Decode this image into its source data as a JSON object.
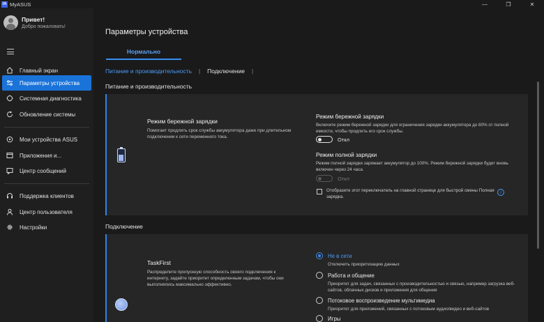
{
  "app": {
    "logo": "/A",
    "title": "MyASUS"
  },
  "window": {
    "minimize": "—",
    "maximize": "❐",
    "close": "✕"
  },
  "user": {
    "greeting": "Привет!",
    "welcome": "Добро пожаловать!"
  },
  "sidebar": {
    "items": [
      {
        "label": "Главный экран",
        "icon": "home-icon"
      },
      {
        "label": "Параметры устройства",
        "icon": "sliders-icon",
        "active": true
      },
      {
        "label": "Системная диагностика",
        "icon": "diagnostics-icon"
      },
      {
        "label": "Обновление системы",
        "icon": "refresh-icon"
      },
      {
        "label": "Мои устройства ASUS",
        "icon": "devices-icon"
      },
      {
        "label": "Приложения и...",
        "icon": "apps-icon"
      },
      {
        "label": "Центр сообщений",
        "icon": "message-icon"
      },
      {
        "label": "Поддержка клиентов",
        "icon": "headset-icon"
      },
      {
        "label": "Центр пользователя",
        "icon": "user-icon"
      },
      {
        "label": "Настройки",
        "icon": "gear-icon"
      }
    ]
  },
  "main": {
    "title": "Параметры устройства",
    "mode_tab": "Нормально",
    "subtabs": [
      "Питание и производительность",
      "Подключение"
    ],
    "sections": {
      "power": {
        "title": "Питание и производительность",
        "card": {
          "title": "Режим бережной зарядки",
          "desc": "Помогает продлить срок службы аккумулятора даже при длительном подключении к сети переменного тока.",
          "care_title": "Режим бережной зарядки",
          "care_desc": "Включите режим бережной зарядки для ограничения зарядки аккумулятора до 80% от полной емкости, чтобы продлить его срок службы.",
          "care_state": "Откл",
          "full_title": "Режим полной зарядки",
          "full_desc": "Режим полной зарядки заряжает аккумулятор до 100%. Режим бережной зарядки будет вновь включен через 24 часа.",
          "full_state": "Откл",
          "checkbox_label": "Отобразите этот переключатель на главной странице для быстрой смены Полная зарядка."
        }
      },
      "connection": {
        "title": "Подключение",
        "card": {
          "title": "TaskFirst",
          "desc": "Распределите пропускную способность своего подключения к интернету, задайте приоритет определенным задачам, чтобы они выполнялись максимально эффективно.",
          "options": [
            {
              "label": "Не в сети",
              "desc": "Отключить приоритизацию данных"
            },
            {
              "label": "Работа и общение",
              "desc": "Приоритет для задач, связанных с производительностью и связью, например загрузка веб-сайтов, облачных дисков и приложения для общения"
            },
            {
              "label": "Потоковое воспроизведение мультимедиа",
              "desc": "Приоритет для приложений, связанных с потоковым аудио/видео и веб-сайтов"
            },
            {
              "label": "Игры",
              "desc": ""
            }
          ]
        }
      }
    },
    "info_glyph": "i"
  },
  "colors": {
    "accent": "#1a73d9",
    "link": "#4c9bf7",
    "bg": "#1a1a1a",
    "card": "#262626"
  }
}
